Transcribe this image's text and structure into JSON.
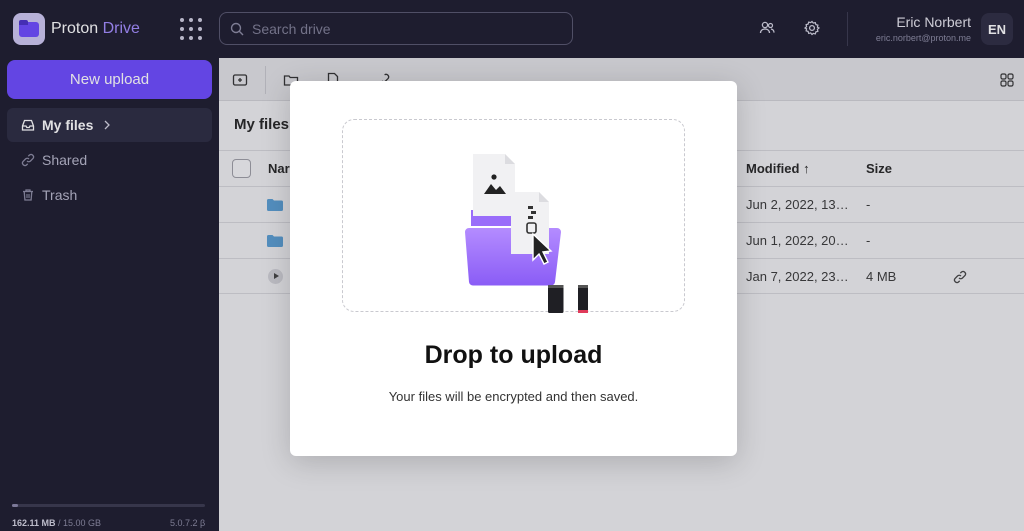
{
  "app": {
    "name_part1": "Proton",
    "name_part2": "Drive"
  },
  "search": {
    "placeholder": "Search drive"
  },
  "user": {
    "name": "Eric Norbert",
    "email": "eric.norbert@proton.me",
    "initials": "EN"
  },
  "sidebar": {
    "new_upload_label": "New upload",
    "items": [
      {
        "label": "My files",
        "icon": "inbox-icon",
        "active": true
      },
      {
        "label": "Shared",
        "icon": "link-icon",
        "active": false
      },
      {
        "label": "Trash",
        "icon": "trash-icon",
        "active": false
      }
    ],
    "storage_used": "162.11 MB",
    "storage_total": " / 15.00 GB",
    "storage_fraction": 0.011,
    "version": "5.0.7.2 β"
  },
  "main": {
    "breadcrumb": "My files",
    "columns": {
      "name": "Nar",
      "modified": "Modified",
      "size": "Size"
    },
    "rows": [
      {
        "type": "folder",
        "modified": "Jun 2, 2022, 13…",
        "size": "-"
      },
      {
        "type": "folder",
        "modified": "Jun 1, 2022, 20…",
        "size": "-"
      },
      {
        "type": "video",
        "modified": "Jan 7, 2022, 23…",
        "size": "4 MB",
        "shared": true
      }
    ]
  },
  "modal": {
    "title": "Drop to upload",
    "subtitle": "Your files will be encrypted and then saved."
  },
  "colors": {
    "accent": "#6d4aff",
    "topbar": "#1c1b2e",
    "folder": "#5a9fd4"
  }
}
